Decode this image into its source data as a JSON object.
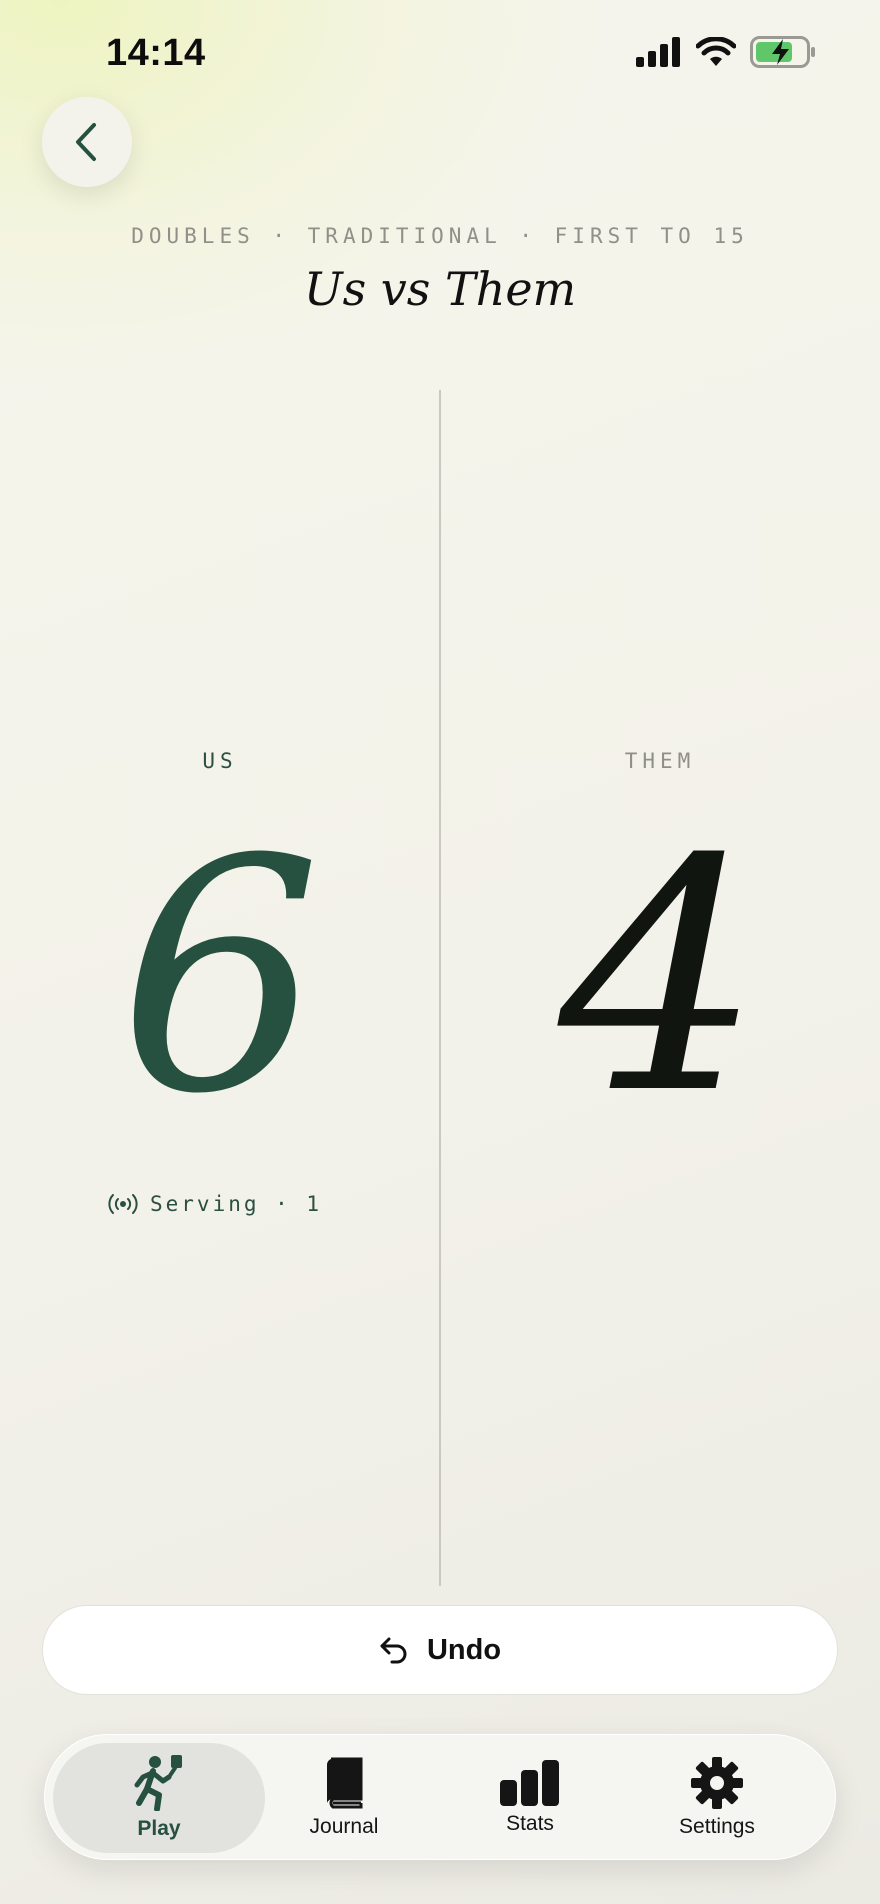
{
  "status_bar": {
    "time": "14:14"
  },
  "header": {
    "subtitle": "DOUBLES · TRADITIONAL · FIRST TO 15",
    "title": "Us vs Them"
  },
  "teams": {
    "us": {
      "label": "US",
      "score": "6"
    },
    "them": {
      "label": "THEM",
      "score": "4"
    }
  },
  "serving": {
    "text": "Serving · 1"
  },
  "undo": {
    "label": "Undo"
  },
  "tab_bar": {
    "items": [
      {
        "label": "Play",
        "icon": "pickleball-player-icon",
        "active": true
      },
      {
        "label": "Journal",
        "icon": "book-icon",
        "active": false
      },
      {
        "label": "Stats",
        "icon": "bar-chart-icon",
        "active": false
      },
      {
        "label": "Settings",
        "icon": "gear-icon",
        "active": false
      }
    ]
  },
  "colors": {
    "accent_green": "#26503f",
    "muted_text": "#909089",
    "battery_green": "#5fc66a"
  }
}
